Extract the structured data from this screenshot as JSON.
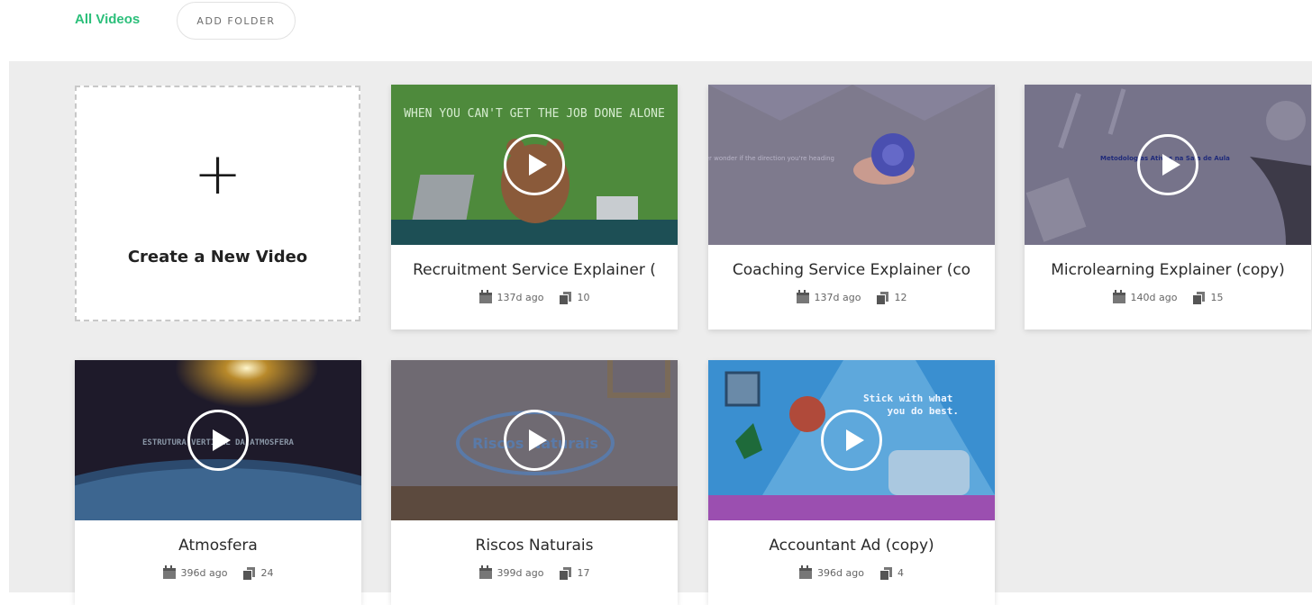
{
  "header": {
    "tab_all_videos": "All Videos",
    "add_folder_label": "ADD FOLDER"
  },
  "create": {
    "plus": "+",
    "label": "Create a New Video"
  },
  "videos": [
    {
      "title": "Recruitment Service Explainer (",
      "age": "137d ago",
      "scenes": "10",
      "thumb_text": "WHEN YOU CAN'T GET THE JOB DONE ALONE"
    },
    {
      "title": "Coaching Service Explainer (co",
      "age": "137d ago",
      "scenes": "12",
      "thumb_text": "Ever wonder if the direction you're heading"
    },
    {
      "title": "Microlearning Explainer (copy)",
      "age": "140d ago",
      "scenes": "15",
      "thumb_text": "Metodologias Ativas na Sala de Aula"
    },
    {
      "title": "Atmosfera",
      "age": "396d ago",
      "scenes": "24",
      "thumb_text": "ESTRUTURA VERTICAL DA ATMOSFERA"
    },
    {
      "title": "Riscos Naturais",
      "age": "399d ago",
      "scenes": "17",
      "thumb_text": "Riscos Naturais"
    },
    {
      "title": "Accountant Ad (copy)",
      "age": "396d ago",
      "scenes": "4",
      "thumb_text": "Stick with what you do best."
    }
  ],
  "colors": {
    "accent": "#2bbf7a",
    "background": "#ededed"
  }
}
